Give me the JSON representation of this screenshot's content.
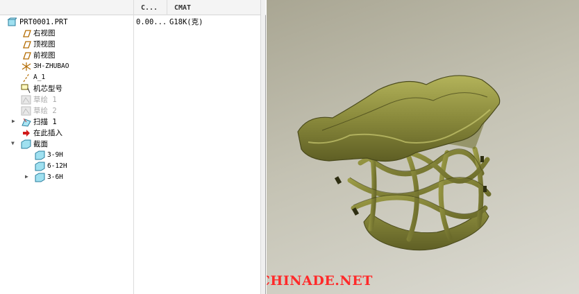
{
  "tree": {
    "columns": [
      "C...",
      "CMAT"
    ],
    "rows": [
      {
        "label": "PRT0001.PRT",
        "icon": "part-icon",
        "col1": "0.00...",
        "col2": "G18K(克)"
      },
      {
        "label": "右视图",
        "icon": "datum-plane-icon"
      },
      {
        "label": "顶视图",
        "icon": "datum-plane-icon"
      },
      {
        "label": "前视图",
        "icon": "datum-plane-icon"
      },
      {
        "label": "3H-ZHUBAO",
        "icon": "coordinate-system-icon"
      },
      {
        "label": "A_1",
        "icon": "datum-axis-icon"
      },
      {
        "label": "机芯型号",
        "icon": "udf-icon"
      },
      {
        "label": "草绘 1",
        "icon": "sketch-icon",
        "dimmed": true
      },
      {
        "label": "草绘 2",
        "icon": "sketch-icon",
        "dimmed": true
      },
      {
        "label": "扫描 1",
        "icon": "sweep-icon"
      },
      {
        "label": "在此插入",
        "icon": "insert-here-arrow-icon"
      },
      {
        "label": "截面",
        "icon": "folder-icon"
      },
      {
        "label": "3-9H",
        "icon": "section-icon"
      },
      {
        "label": "6-12H",
        "icon": "section-icon"
      },
      {
        "label": "3-6H",
        "icon": "section-icon"
      }
    ]
  },
  "viewport": {
    "model_color": "#8a8a3c",
    "watermark": "BBS.CHINADE.NET"
  }
}
